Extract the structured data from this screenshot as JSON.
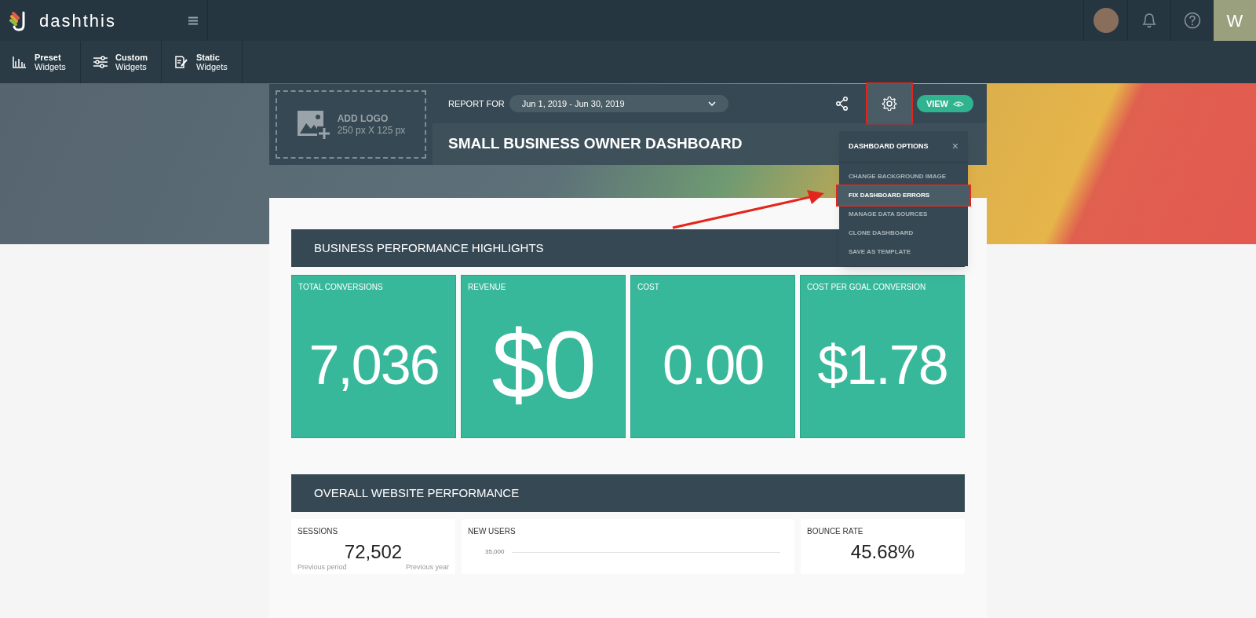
{
  "brand": {
    "name": "dashthis"
  },
  "toolbar": [
    {
      "kind": "preset",
      "title": "Preset",
      "subtitle": "Widgets"
    },
    {
      "kind": "custom",
      "title": "Custom",
      "subtitle": "Widgets"
    },
    {
      "kind": "static",
      "title": "Static",
      "subtitle": "Widgets"
    }
  ],
  "user": {
    "initial": "W"
  },
  "header": {
    "logo_label": "ADD LOGO",
    "logo_size": "250 px X 125 px",
    "report_for": "REPORT FOR",
    "date_range": "Jun 1, 2019 - Jun 30, 2019",
    "title": "SMALL BUSINESS OWNER DASHBOARD",
    "view_button": "VIEW",
    "settings_highlighted": true
  },
  "dashboard_options": {
    "title": "DASHBOARD OPTIONS",
    "close": "×",
    "items": [
      {
        "label": "CHANGE BACKGROUND IMAGE",
        "selected": false
      },
      {
        "label": "FIX DASHBOARD ERRORS",
        "selected": true
      },
      {
        "label": "MANAGE DATA SOURCES",
        "selected": false
      },
      {
        "label": "CLONE DASHBOARD",
        "selected": false
      },
      {
        "label": "SAVE AS TEMPLATE",
        "selected": false
      }
    ]
  },
  "sections": [
    {
      "title": "BUSINESS PERFORMANCE HIGHLIGHTS",
      "tiles": [
        {
          "label": "TOTAL CONVERSIONS",
          "value": "7,036"
        },
        {
          "label": "REVENUE",
          "value": "$0"
        },
        {
          "label": "COST",
          "value": "0.00"
        },
        {
          "label": "COST PER GOAL CONVERSION",
          "value": "$1.78"
        }
      ]
    },
    {
      "title": "OVERALL WEBSITE PERFORMANCE",
      "cards": [
        {
          "kind": "number",
          "label": "SESSIONS",
          "value": "72,502",
          "footer": [
            "Previous period",
            "Previous year"
          ]
        },
        {
          "kind": "chart",
          "label": "NEW USERS",
          "tick": "35,000"
        },
        {
          "kind": "number",
          "label": "BOUNCE RATE",
          "value": "45.68%"
        }
      ]
    }
  ]
}
